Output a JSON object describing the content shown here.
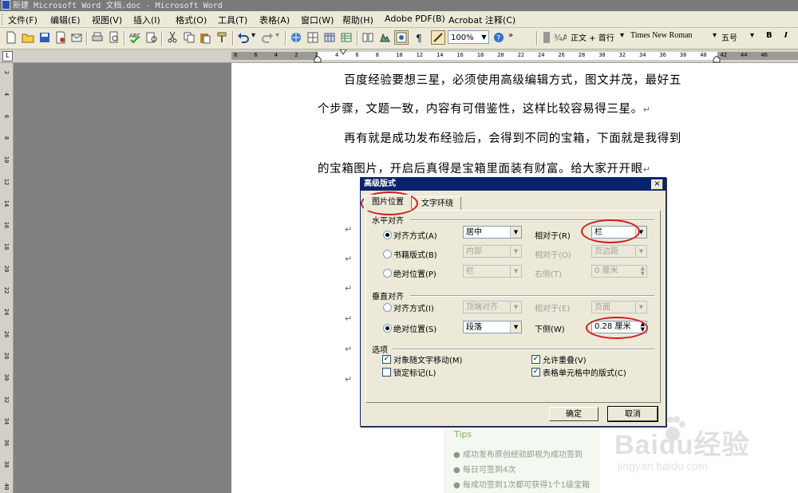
{
  "window": {
    "title": "新建 Microsoft Word 文档.doc - Microsoft Word"
  },
  "menu": [
    "文件(F)",
    "编辑(E)",
    "视图(V)",
    "插入(I)",
    "格式(O)",
    "工具(T)",
    "表格(A)",
    "窗口(W)",
    "帮助(H)",
    "Adobe PDF(B)",
    "Acrobat 注释(C)"
  ],
  "toolbar": {
    "zoom": "100%",
    "style": "正文 + 首行",
    "font": "Times New Roman",
    "size": "五号",
    "bold": "B",
    "italic": "I"
  },
  "ruler": {
    "h_ticks": [
      "8",
      "6",
      "4",
      "2",
      "2",
      "4",
      "6",
      "8",
      "10",
      "12",
      "14",
      "16",
      "18",
      "20",
      "22",
      "24",
      "26",
      "28",
      "30",
      "32",
      "34",
      "36",
      "38",
      "40",
      "42",
      "44",
      "46"
    ],
    "v_ticks": [
      "2",
      "4",
      "6",
      "8",
      "10",
      "12",
      "14",
      "16",
      "18",
      "20",
      "22",
      "24",
      "26",
      "28",
      "30",
      "32",
      "34",
      "36",
      "38",
      "40"
    ]
  },
  "document": {
    "lines": [
      "百度经验要想三星，必须使用高级编辑方式，图文并茂，最好五",
      "个步骤，文题一致，内容有可借鉴性，这样比较容易得三星。",
      "再有就是成功发布经验后，会得到不同的宝箱，下面就是我得到",
      "的宝箱图片，开启后真得是宝箱里面装有财富。给大家开开眼"
    ],
    "para_mark": "↵"
  },
  "tips": {
    "title": "Tips",
    "items": [
      "成功发布原创经验即视为成功签到",
      "每日可签到4次",
      "每成功签到1次都可获得1个1级宝箱"
    ]
  },
  "watermark": {
    "brand": "Baidu经验",
    "url": "jingyan.baidu.com"
  },
  "dialog": {
    "title": "高级版式",
    "close": "×",
    "tabs": [
      "图片位置",
      "文字环绕"
    ],
    "horizontal": {
      "heading": "水平对齐",
      "align_label": "对齐方式(A)",
      "align_value": "居中",
      "relative_label": "相对于(R)",
      "relative_value": "栏",
      "book_label": "书籍版式(B)",
      "book_value": "内部",
      "book_rel_label": "相对于(O)",
      "book_rel_value": "页边距",
      "abs_label": "绝对位置(P)",
      "abs_value": "栏",
      "right_label": "右侧(T)",
      "right_value": "0 厘米"
    },
    "vertical": {
      "heading": "垂直对齐",
      "align_label": "对齐方式(I)",
      "align_value": "顶端对齐",
      "relative_label": "相对于(E)",
      "relative_value": "页面",
      "abs_label": "绝对位置(S)",
      "abs_value": "段落",
      "below_label": "下侧(W)",
      "below_value": "0.28 厘米"
    },
    "options": {
      "heading": "选项",
      "move_with_text": "对象随文字移动(M)",
      "allow_overlap": "允许重叠(V)",
      "lock_anchor": "锁定标记(L)",
      "layout_in_cell": "表格单元格中的版式(C)"
    },
    "ok": "确定",
    "cancel": "取消"
  }
}
